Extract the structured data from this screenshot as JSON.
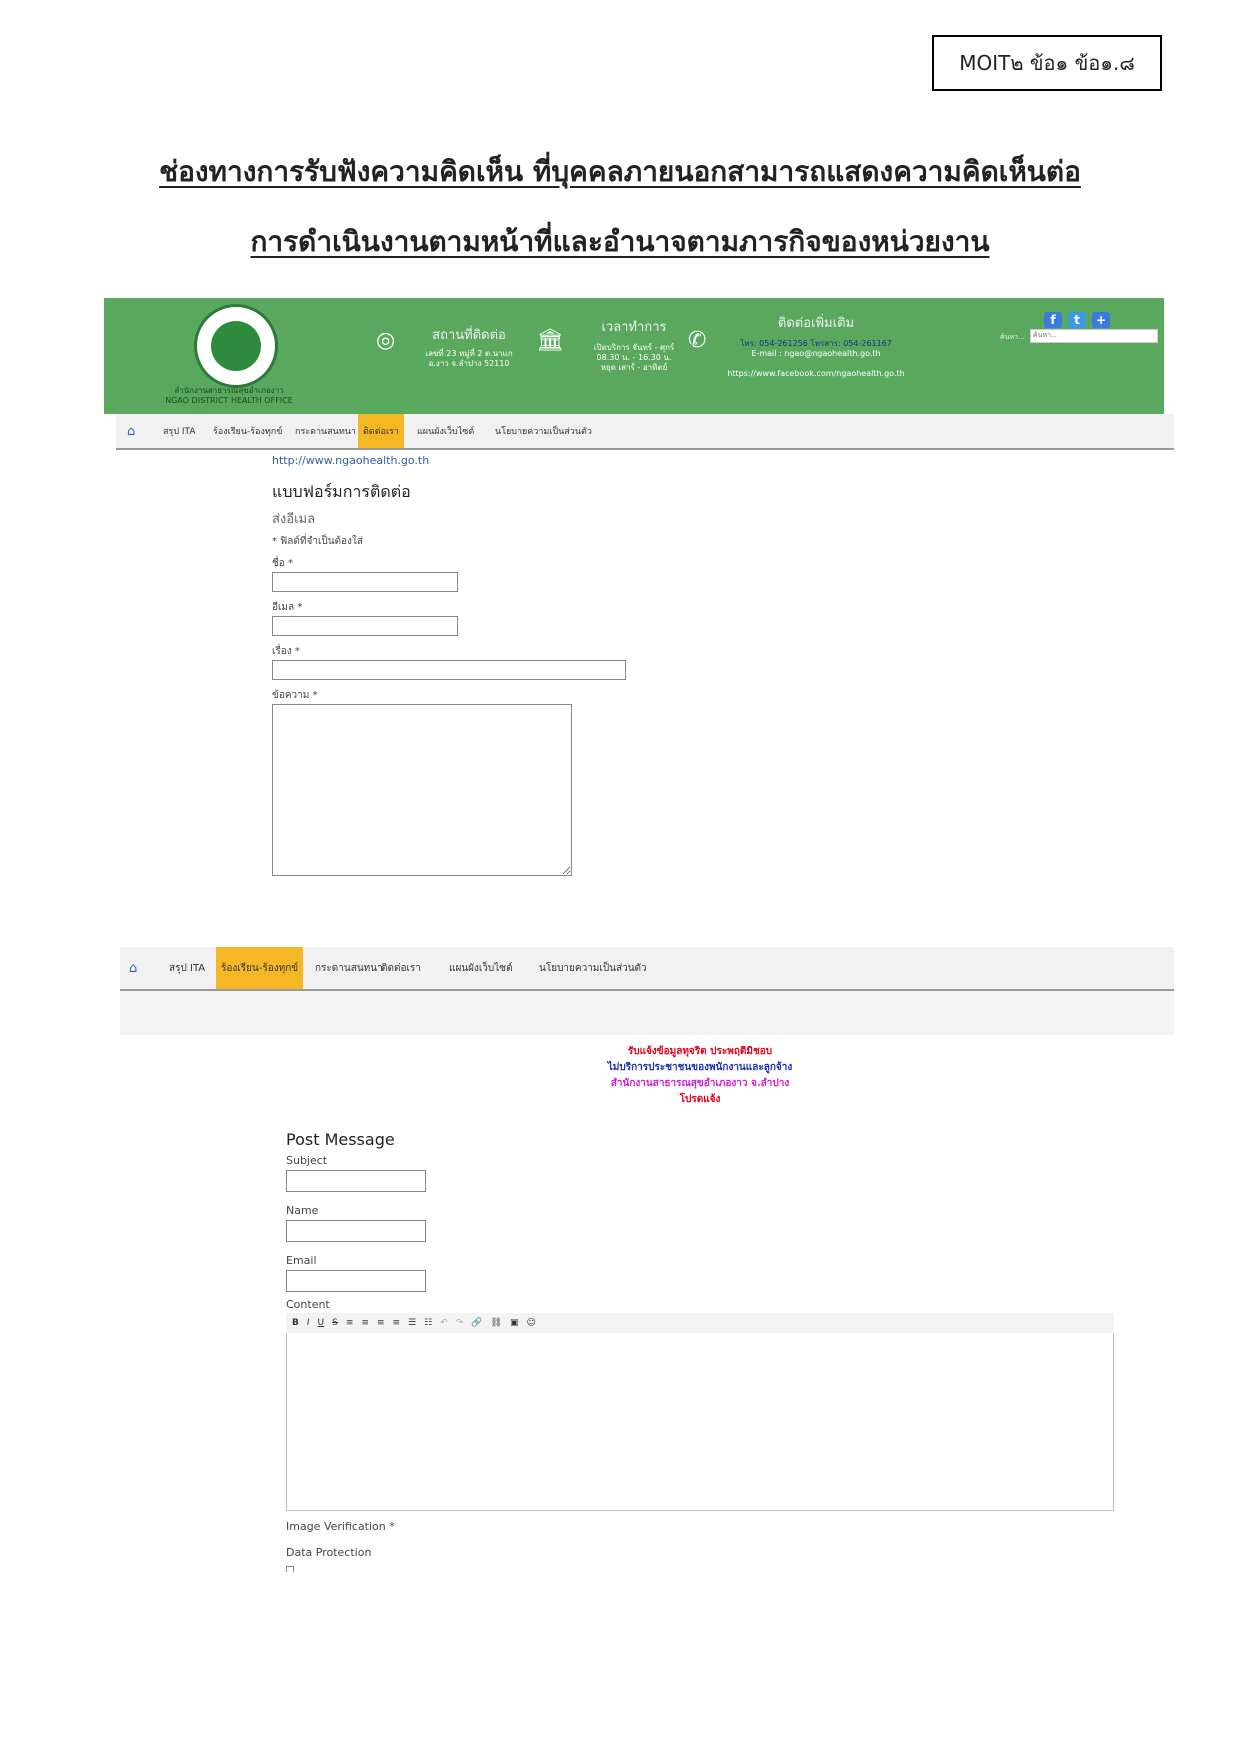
{
  "doc_code": "MOIT๒ ข้อ๑ ข้อ๑.๘",
  "title_line1": "ช่องทางการรับฟังความคิดเห็น ที่บุคคลภายนอกสามารถแสดงความคิดเห็นต่อ",
  "title_line2": "การดำเนินงานตามหน้าที่และอำนาจตามภารกิจของหน่วยงาน",
  "header": {
    "org_name_th": "สำนักงานสาธารณสุขอำเภองาว",
    "org_name_en": "NGAO DISTRICT HEALTH OFFICE",
    "location_heading": "สถานที่ติดต่อ",
    "location_line1": "เลขที่ 23 หมู่ที่ 2 ต.นาแก",
    "location_line2": "อ.งาว จ.ลำปาง 52110",
    "hours_heading": "เวลาทำการ",
    "hours_line1": "เปิดบริการ จันทร์ - ศุกร์",
    "hours_line2": "08.30 น. - 16.30 น.",
    "hours_line3": "หยุด เสาร์ - อาทิตย์",
    "contact_heading": "ติดต่อเพิ่มเติม",
    "contact_phone": "โทร: 054-261256 โทรสาร: 054-261167",
    "contact_email": "E-mail : ngao@ngaohealth.go.th",
    "contact_facebook": "https://www.facebook.com/ngaohealth.go.th",
    "search_label": "ค้นหา...",
    "search_placeholder": "ค้นหา..."
  },
  "colors": {
    "header_green": "#5aa85e",
    "active_tab": "#f5b724",
    "link_blue": "#2f5fa8"
  },
  "nav1": {
    "items": [
      "สรุป ITA",
      "ร้องเรียน-ร้องทุกข์",
      "กระดานสนทนา",
      "ติดต่อเรา",
      "แผนผังเว็บไซต์",
      "นโยบายความเป็นส่วนตัว"
    ]
  },
  "form1": {
    "url": "http://www.ngaohealth.go.th",
    "heading": "แบบฟอร์มการติดต่อ",
    "subheading": "ส่งอีเมล",
    "required_note": "* ฟิลด์ที่จำเป็นต้องใส่",
    "name_label": "ชื่อ *",
    "email_label": "อีเมล *",
    "subject_label": "เรื่อง *",
    "message_label": "ข้อความ *"
  },
  "nav2": {
    "items": [
      "สรุป ITA",
      "ร้องเรียน-ร้องทุกข์",
      "กระดานสนทนา",
      "ติดต่อเรา",
      "แผนผังเว็บไซต์",
      "นโยบายความเป็นส่วนตัว"
    ]
  },
  "notice": {
    "line1": "รับแจ้งข้อมูลทุจริต ประพฤติมิชอบ",
    "line2": "ไม่บริการประชาชนของพนักงานและลูกจ้าง",
    "line3": "สำนักงานสาธารณสุขอำเภองาว จ.ลำปาง",
    "line4": "โปรดแจ้ง"
  },
  "form2": {
    "heading": "Post Message",
    "subject_label": "Subject",
    "name_label": "Name",
    "email_label": "Email",
    "content_label": "Content",
    "image_verification_label": "Image Verification *",
    "data_protection_label": "Data Protection"
  }
}
